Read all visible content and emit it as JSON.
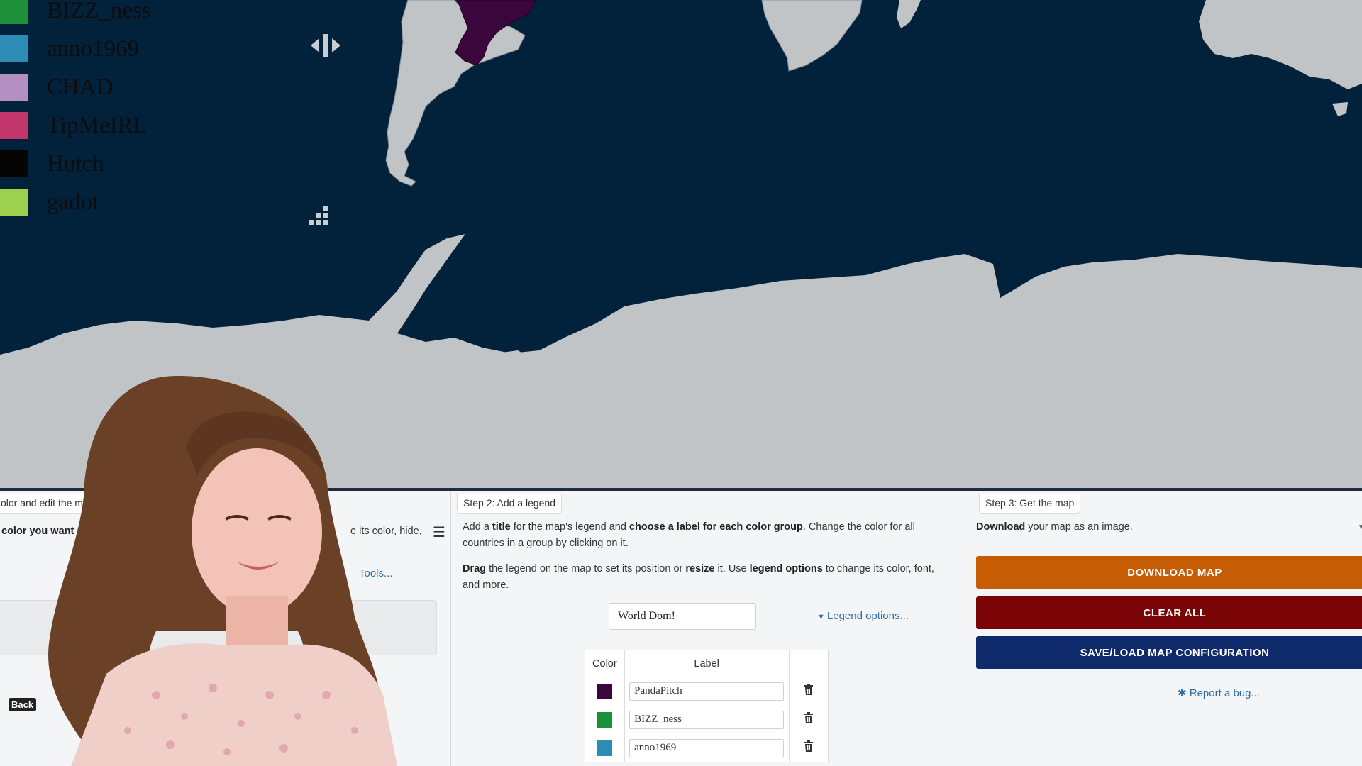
{
  "colors": {
    "ocean": "#02213b",
    "land": "#c0c4c7",
    "highlight": "#3a063c",
    "download": "#c65d04",
    "clear": "#7a0306",
    "saveload": "#0f2a6b"
  },
  "map_legend": {
    "items": [
      {
        "label": "BIZZ_ness",
        "color": "#1f8f3a"
      },
      {
        "label": "anno1969",
        "color": "#2d8cb5"
      },
      {
        "label": "CHAD",
        "color": "#b48fc4"
      },
      {
        "label": "TipMeIRL",
        "color": "#c2376b"
      },
      {
        "label": "Hutch",
        "color": "#050505"
      },
      {
        "label": "gadot",
        "color": "#9ed04f"
      }
    ]
  },
  "step1": {
    "tab": "olor and edit the map",
    "text_left": "color you want and click o",
    "text_right": "e its color, hide,",
    "tools_link": "Tools...",
    "back_badge": "Back"
  },
  "step2": {
    "tab": "Step 2: Add a legend",
    "para1": {
      "a": "Add a ",
      "b": "title",
      "c": " for the map's legend and ",
      "d": "choose a label for each color group",
      "e": ". Change the color for all countries in a group by clicking on it."
    },
    "para2": {
      "a": "Drag",
      "b": " the legend on the map to set its position or ",
      "c": "resize",
      "d": " it. Use ",
      "e": "legend options",
      "f": " to change its color, font, and more."
    },
    "legend_title_value": "World Dom!",
    "legend_options_link": "Legend options...",
    "table": {
      "col_color": "Color",
      "col_label": "Label",
      "rows": [
        {
          "color": "#3a063c",
          "label": "PandaPitch"
        },
        {
          "color": "#1f8f3a",
          "label": "BIZZ_ness"
        },
        {
          "color": "#2d8cb5",
          "label": "anno1969"
        }
      ]
    }
  },
  "step3": {
    "tab": "Step 3: Get the map",
    "para": {
      "a": "Download",
      "b": " your map as an image."
    },
    "download_button": "DOWNLOAD MAP",
    "clear_button": "CLEAR ALL",
    "saveload_button": "SAVE/LOAD MAP CONFIGURATION",
    "report_bug": "Report a bug..."
  }
}
